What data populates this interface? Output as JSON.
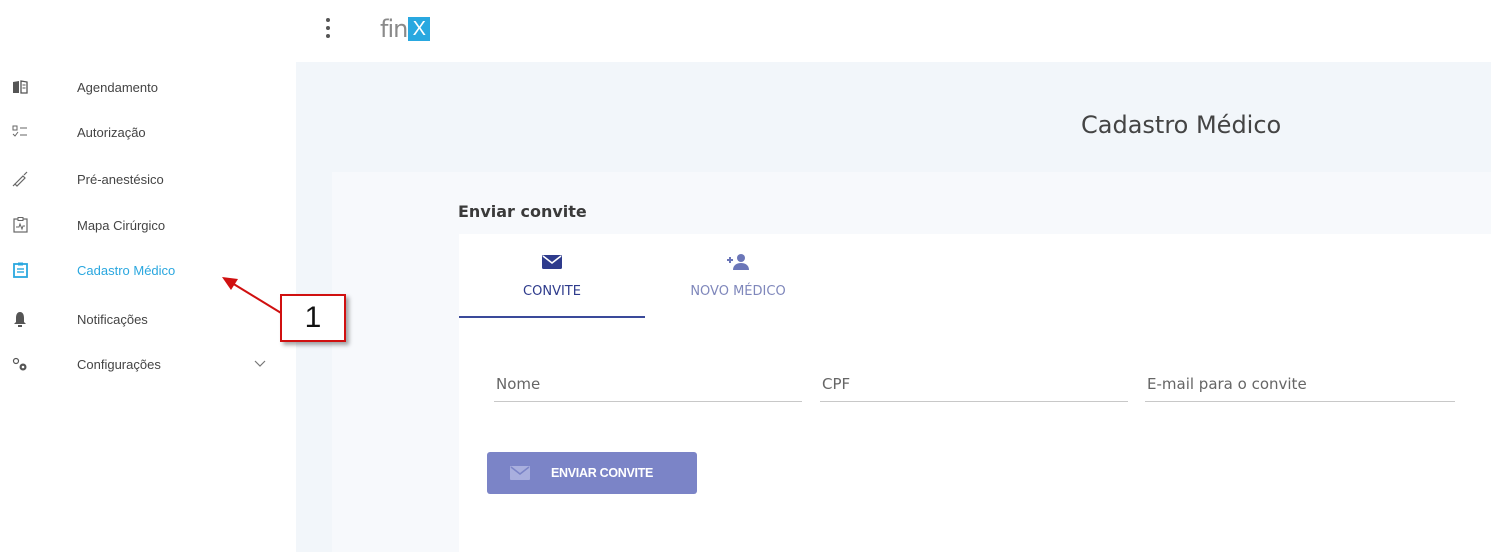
{
  "app": {
    "logo_text": "fin",
    "logo_mark": "X",
    "brand_color": "#29a8e0"
  },
  "sidebar": {
    "items": [
      {
        "label": "Agendamento",
        "icon": "book-icon",
        "active": false
      },
      {
        "label": "Autorização",
        "icon": "checklist-icon",
        "active": false
      },
      {
        "label": "Pré-anestésico",
        "icon": "syringe-icon",
        "active": false
      },
      {
        "label": "Mapa Cirúrgico",
        "icon": "monitor-chart-icon",
        "active": false
      },
      {
        "label": "Cadastro Médico",
        "icon": "clipboard-icon",
        "active": true
      },
      {
        "label": "Notificações",
        "icon": "bell-icon",
        "active": false
      },
      {
        "label": "Configurações",
        "icon": "gears-icon",
        "active": false,
        "expandable": true
      }
    ],
    "active_color": "#2aa7df"
  },
  "main": {
    "page_title": "Cadastro Médico",
    "section_title": "Enviar convite",
    "tabs": [
      {
        "label": "CONVITE",
        "icon": "mail-icon",
        "selected": true
      },
      {
        "label": "NOVO MÉDICO",
        "icon": "add-person-icon",
        "selected": false
      }
    ],
    "form": {
      "nome_placeholder": "Nome",
      "cpf_placeholder": "CPF",
      "email_placeholder": "E-mail para o convite"
    },
    "send_button_label": "ENVIAR CONVITE",
    "button_color": "#7b84c7"
  },
  "annotation": {
    "number": "1"
  }
}
